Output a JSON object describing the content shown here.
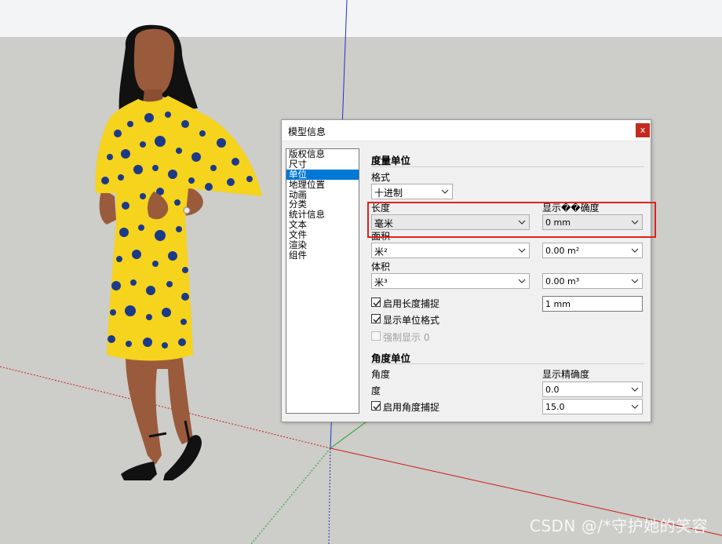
{
  "watermark": "CSDN @/*守护她的笑容",
  "dialog": {
    "title": "模型信息",
    "close_glyph": "x",
    "nav_items": [
      {
        "label": "版权信息",
        "selected": false
      },
      {
        "label": "尺寸",
        "selected": false
      },
      {
        "label": "单位",
        "selected": true
      },
      {
        "label": "地理位置",
        "selected": false
      },
      {
        "label": "动画",
        "selected": false
      },
      {
        "label": "分类",
        "selected": false
      },
      {
        "label": "统计信息",
        "selected": false
      },
      {
        "label": "文本",
        "selected": false
      },
      {
        "label": "文件",
        "selected": false
      },
      {
        "label": "渲染",
        "selected": false
      },
      {
        "label": "组件",
        "selected": false
      }
    ],
    "units": {
      "section_title": "度量单位",
      "format_label": "格式",
      "format_value": "十进制",
      "length_label": "长度",
      "length_value": "毫米",
      "precision_label": "显示��确度",
      "length_precision": "0 mm",
      "area_label": "面积",
      "area_value": "米²",
      "area_precision": "0.00 m²",
      "volume_label": "体积",
      "volume_value": "米³",
      "volume_precision": "0.00 m³",
      "enable_length_snap": {
        "label": "启用长度捕捉",
        "checked": true
      },
      "length_snap_value": "1 mm",
      "show_unit_format": {
        "label": "显示单位格式",
        "checked": true
      },
      "force_display": {
        "label": "强制显示 0",
        "checked": false,
        "enabled": false
      }
    },
    "angle": {
      "section_title": "角度单位",
      "angle_label": "角度",
      "precision_label": "显示精确度",
      "degree_label": "度",
      "precision_value": "0.0",
      "enable_angle_snap": {
        "label": "启用角度捕捉",
        "checked": true
      },
      "snap_value": "15.0"
    }
  },
  "colors": {
    "sky": "#f3f4f6",
    "ground": "#cdcdc9",
    "selection": "#0078d7",
    "highlight_box": "#e0201b",
    "close_button": "#c42b1c",
    "dress_yellow": "#f6d31c",
    "dress_spots": "#1b3a8a",
    "skin": "#9a5a3c"
  }
}
